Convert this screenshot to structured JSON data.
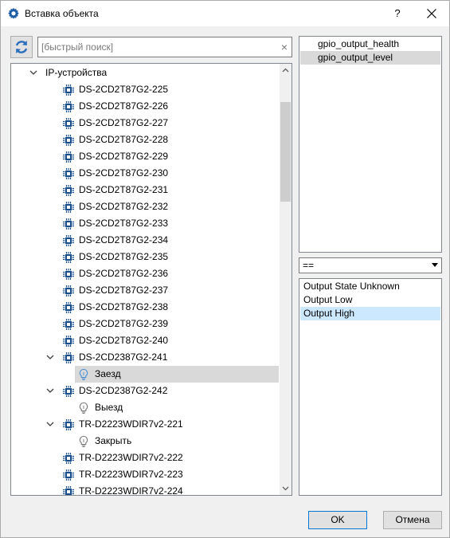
{
  "window": {
    "title": "Вставка объекта",
    "help_label": "?"
  },
  "search": {
    "placeholder": "[быстрый поиск]",
    "clear_label": "×"
  },
  "tree": {
    "items": [
      {
        "label": "IP-устройства",
        "level": 0,
        "expanded": true,
        "icon": "none"
      },
      {
        "label": "DS-2CD2T87G2-225",
        "level": 1,
        "icon": "chip-icon"
      },
      {
        "label": "DS-2CD2T87G2-226",
        "level": 1,
        "icon": "chip-icon"
      },
      {
        "label": "DS-2CD2T87G2-227",
        "level": 1,
        "icon": "chip-icon"
      },
      {
        "label": "DS-2CD2T87G2-228",
        "level": 1,
        "icon": "chip-icon"
      },
      {
        "label": "DS-2CD2T87G2-229",
        "level": 1,
        "icon": "chip-icon"
      },
      {
        "label": "DS-2CD2T87G2-230",
        "level": 1,
        "icon": "chip-icon"
      },
      {
        "label": "DS-2CD2T87G2-231",
        "level": 1,
        "icon": "chip-icon"
      },
      {
        "label": "DS-2CD2T87G2-232",
        "level": 1,
        "icon": "chip-icon"
      },
      {
        "label": "DS-2CD2T87G2-233",
        "level": 1,
        "icon": "chip-icon"
      },
      {
        "label": "DS-2CD2T87G2-234",
        "level": 1,
        "icon": "chip-icon"
      },
      {
        "label": "DS-2CD2T87G2-235",
        "level": 1,
        "icon": "chip-icon"
      },
      {
        "label": "DS-2CD2T87G2-236",
        "level": 1,
        "icon": "chip-icon"
      },
      {
        "label": "DS-2CD2T87G2-237",
        "level": 1,
        "icon": "chip-icon"
      },
      {
        "label": "DS-2CD2T87G2-238",
        "level": 1,
        "icon": "chip-icon"
      },
      {
        "label": "DS-2CD2T87G2-239",
        "level": 1,
        "icon": "chip-icon"
      },
      {
        "label": "DS-2CD2T87G2-240",
        "level": 1,
        "icon": "chip-icon"
      },
      {
        "label": "DS-2CD2387G2-241",
        "level": 1,
        "expanded": true,
        "icon": "chip-icon"
      },
      {
        "label": "Заезд",
        "level": 2,
        "icon": "lightbulb-icon",
        "selected": true
      },
      {
        "label": "DS-2CD2387G2-242",
        "level": 1,
        "expanded": true,
        "icon": "chip-icon"
      },
      {
        "label": "Выезд",
        "level": 2,
        "icon": "lightbulb-icon"
      },
      {
        "label": "TR-D2223WDIR7v2-221",
        "level": 1,
        "expanded": true,
        "icon": "chip-icon"
      },
      {
        "label": "Закрыть",
        "level": 2,
        "icon": "lightbulb-icon"
      },
      {
        "label": "TR-D2223WDIR7v2-222",
        "level": 1,
        "icon": "chip-icon"
      },
      {
        "label": "TR-D2223WDIR7v2-223",
        "level": 1,
        "icon": "chip-icon"
      },
      {
        "label": "TR-D2223WDIR7v2-224",
        "level": 1,
        "icon": "chip-icon"
      }
    ]
  },
  "properties": {
    "items": [
      {
        "label": "gpio_output_health",
        "selected": false
      },
      {
        "label": "gpio_output_level",
        "selected": true
      }
    ]
  },
  "operator": {
    "value": "=="
  },
  "values": {
    "items": [
      {
        "label": "Output State Unknown",
        "selected": false
      },
      {
        "label": "Output Low",
        "selected": false
      },
      {
        "label": "Output High",
        "selected": true
      }
    ]
  },
  "buttons": {
    "ok": "OK",
    "cancel": "Отмена"
  },
  "colors": {
    "selection_gray": "#d9d9d9",
    "selection_blue": "#cce8ff",
    "chip_icon": "#1a4f8c",
    "refresh_icon": "#2a6ebb"
  }
}
